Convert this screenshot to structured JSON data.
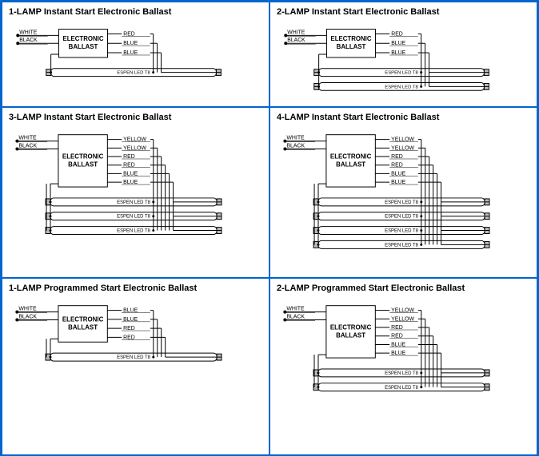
{
  "common": {
    "ballast_box": "ELECTRONIC\nBALLAST",
    "tube_label": "ESPEN LED T8",
    "ballast_type_instant": "Instant Start Electronic Ballast",
    "ballast_type_programmed": "Programmed Start Electronic Ballast"
  },
  "wires": {
    "white": "WHITE",
    "black": "BLACK",
    "red": "RED",
    "blue": "BLUE",
    "yellow": "YELLOW"
  },
  "cells": [
    {
      "lamp_prefix": "1-LAMP",
      "type_key": "ballast_type_instant",
      "inputs": [
        "white",
        "black"
      ],
      "outputs": [
        "red",
        "blue",
        "blue"
      ],
      "tubes": 1
    },
    {
      "lamp_prefix": "2-LAMP",
      "type_key": "ballast_type_instant",
      "inputs": [
        "white",
        "black"
      ],
      "outputs": [
        "red",
        "blue",
        "blue"
      ],
      "tubes": 2
    },
    {
      "lamp_prefix": "3-LAMP",
      "type_key": "ballast_type_instant",
      "inputs": [
        "white",
        "black"
      ],
      "outputs": [
        "yellow",
        "yellow",
        "red",
        "red",
        "blue",
        "blue"
      ],
      "tubes": 3
    },
    {
      "lamp_prefix": "4-LAMP",
      "type_key": "ballast_type_instant",
      "inputs": [
        "white",
        "black"
      ],
      "outputs": [
        "yellow",
        "yellow",
        "red",
        "red",
        "blue",
        "blue"
      ],
      "tubes": 4
    },
    {
      "lamp_prefix": "1-LAMP",
      "type_key": "ballast_type_programmed",
      "inputs": [
        "white",
        "black"
      ],
      "outputs": [
        "blue",
        "blue",
        "red",
        "red"
      ],
      "tubes": 1
    },
    {
      "lamp_prefix": "2-LAMP",
      "type_key": "ballast_type_programmed",
      "inputs": [
        "white",
        "black"
      ],
      "outputs": [
        "yellow",
        "yellow",
        "red",
        "red",
        "blue",
        "blue"
      ],
      "tubes": 2
    }
  ]
}
